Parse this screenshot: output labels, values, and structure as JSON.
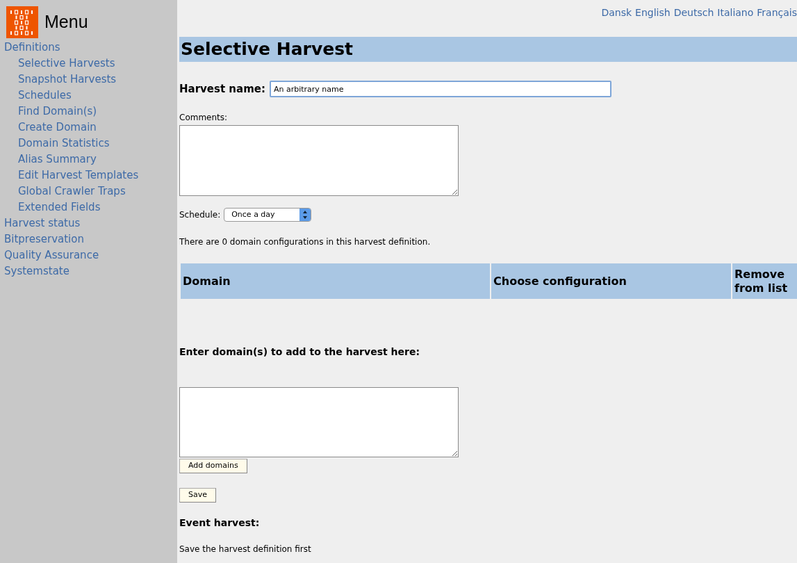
{
  "sidebar": {
    "title": "Menu",
    "items": [
      {
        "label": "Definitions",
        "children": [
          {
            "label": "Selective Harvests"
          },
          {
            "label": "Snapshot Harvests"
          },
          {
            "label": "Schedules"
          },
          {
            "label": "Find Domain(s)"
          },
          {
            "label": "Create Domain"
          },
          {
            "label": "Domain Statistics"
          },
          {
            "label": "Alias Summary"
          },
          {
            "label": "Edit Harvest Templates"
          },
          {
            "label": "Global Crawler Traps"
          },
          {
            "label": "Extended Fields"
          }
        ]
      },
      {
        "label": "Harvest status"
      },
      {
        "label": "Bitpreservation"
      },
      {
        "label": "Quality Assurance"
      },
      {
        "label": "Systemstate"
      }
    ]
  },
  "languages": [
    "Dansk",
    "English",
    "Deutsch",
    "Italiano",
    "Français"
  ],
  "page_title": "Selective Harvest",
  "harvest_name": {
    "label": "Harvest name:",
    "value": "An arbitrary name"
  },
  "comments": {
    "label": "Comments:"
  },
  "schedule": {
    "label": "Schedule:",
    "value": "Once a day"
  },
  "config_count_text": "There are 0 domain configurations in this harvest definition.",
  "table": {
    "columns": [
      "Domain",
      "Choose configuration",
      "Remove from list"
    ]
  },
  "add_domains": {
    "heading": "Enter domain(s) to add to the harvest here:",
    "button": "Add domains"
  },
  "save_button": "Save",
  "event_harvest": {
    "heading": "Event harvest:",
    "text": "Save the harvest definition first"
  }
}
